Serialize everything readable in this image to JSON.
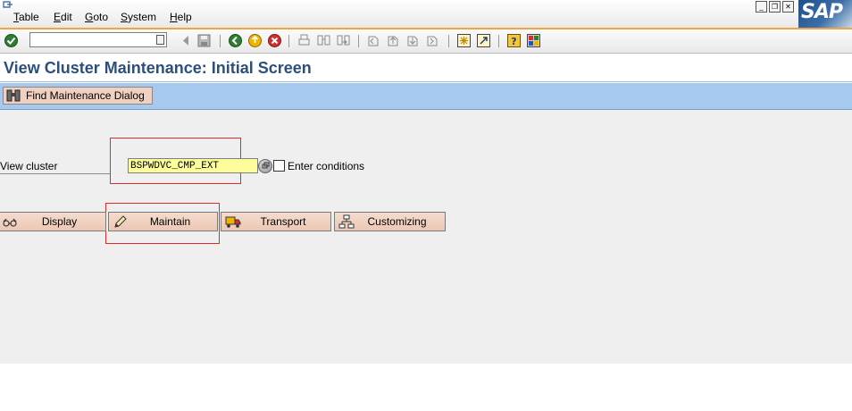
{
  "menu": {
    "items": [
      "Table",
      "Edit",
      "Goto",
      "System",
      "Help"
    ],
    "window_controls": [
      "minimize",
      "restore",
      "close"
    ],
    "logo": "SAP"
  },
  "toolbar": {
    "command_field": {
      "value": "",
      "placeholder": ""
    },
    "icons": [
      "enter-icon",
      "back-icon",
      "save-icon",
      "back-arrow-icon",
      "exit-icon",
      "cancel-icon",
      "print-icon",
      "find-icon",
      "find-next-icon",
      "first-page-icon",
      "previous-page-icon",
      "next-page-icon",
      "last-page-icon",
      "create-session-icon",
      "shortcut-icon",
      "help-icon",
      "layout-menu-icon"
    ]
  },
  "title": "View Cluster Maintenance: Initial Screen",
  "app_toolbar": {
    "find_button_label": "Find Maintenance Dialog"
  },
  "form": {
    "view_cluster_label": "View cluster",
    "view_cluster_value": "BSPWDVC_CMP_EXT",
    "enter_conditions_label": "Enter conditions",
    "enter_conditions_checked": false
  },
  "actions": {
    "display": "Display",
    "maintain": "Maintain",
    "transport": "Transport",
    "customizing": "Customizing"
  },
  "colors": {
    "highlight": "#e02b2b",
    "input_bg": "#fdfd9c",
    "app_toolbar_bg": "#a6c9ef",
    "content_bg": "#efeff0",
    "button_bg": "#f0d0c0",
    "title_color": "#2c4f7c"
  }
}
